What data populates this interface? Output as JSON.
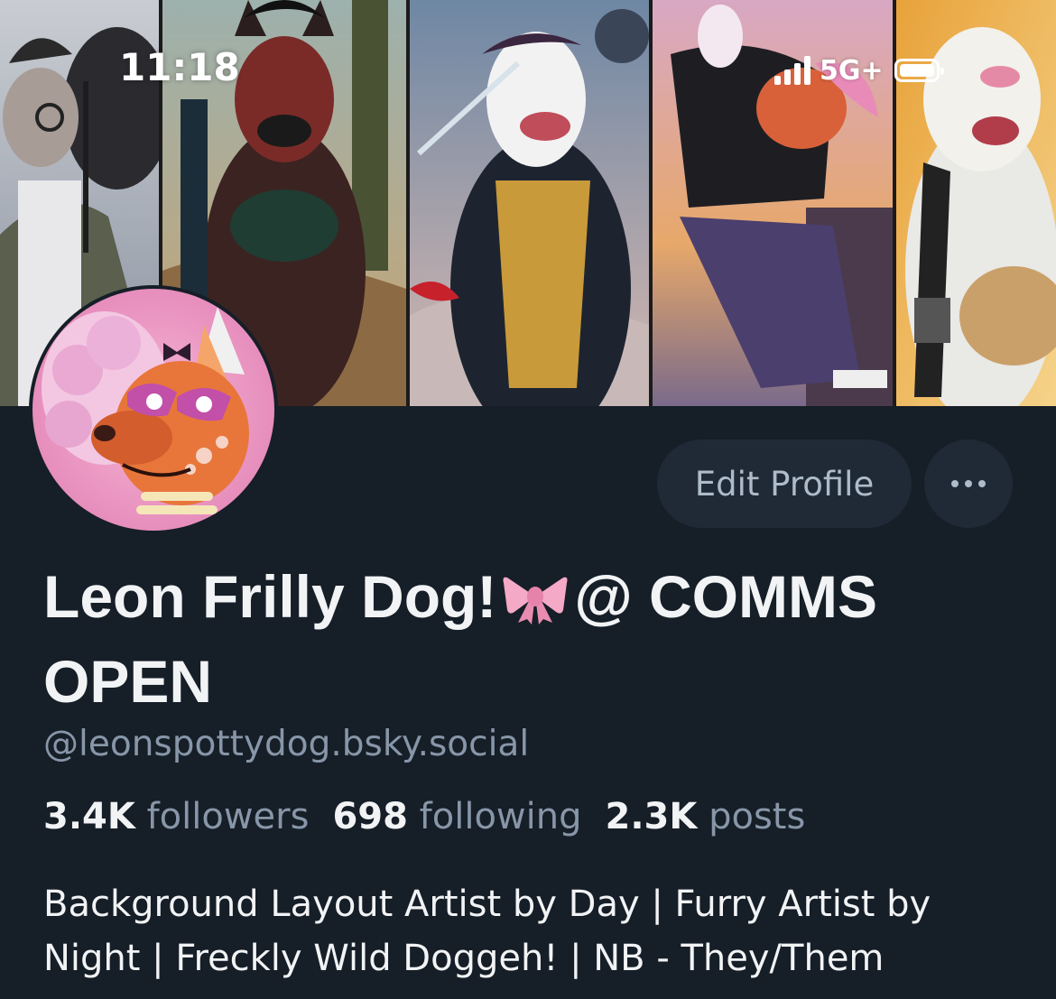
{
  "status_bar": {
    "time": "11:18",
    "network": "5G+",
    "signal_icon": "cellular-signal-icon",
    "battery_icon": "battery-full-icon"
  },
  "banner": {
    "panel_count": 5
  },
  "profile": {
    "display_name_part1": "Leon Frilly Dog!",
    "display_name_emoji": "🎀",
    "display_name_part2": "@ COMMS OPEN",
    "handle": "@leonspottydog.bsky.social",
    "edit_button": "Edit Profile",
    "more_icon": "ellipsis-icon"
  },
  "stats": {
    "followers_count": "3.4K",
    "followers_label": "followers",
    "following_count": "698",
    "following_label": "following",
    "posts_count": "2.3K",
    "posts_label": "posts"
  },
  "bio": {
    "line1": "Background Layout Artist by Day | Furry Artist by",
    "line2": "Night | Freckly Wild Doggeh! | NB - They/Them"
  },
  "colors": {
    "background": "#161e27",
    "button_bg": "#1f2a36",
    "muted_text": "#8796a8",
    "primary_text": "#f1f3f5"
  }
}
